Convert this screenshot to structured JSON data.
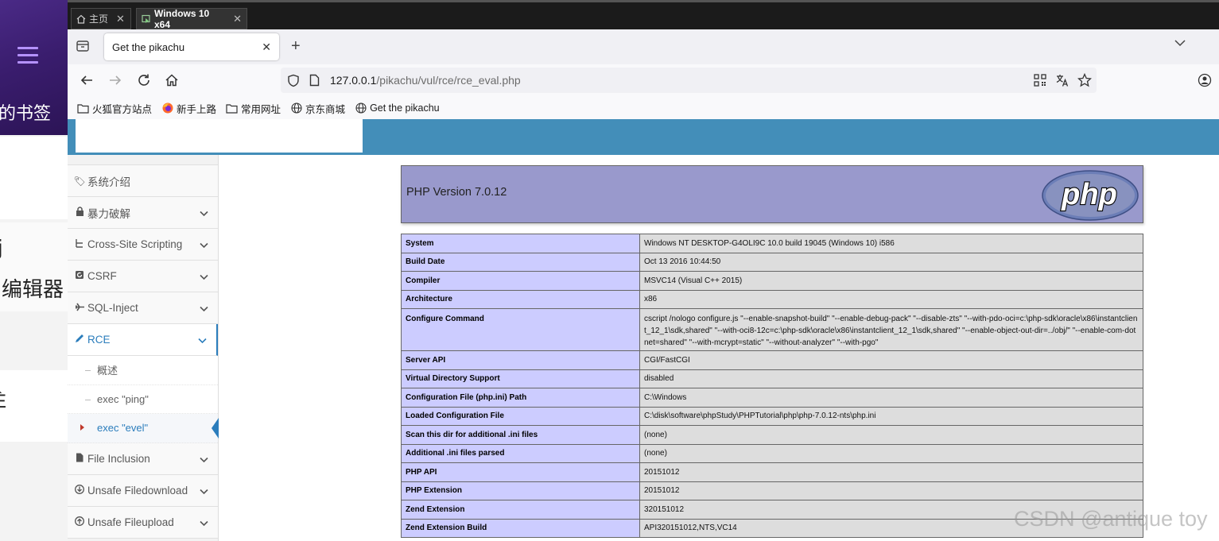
{
  "left_app": {
    "bookmarks_fragment": "的书签",
    "glyph_fragment": "j",
    "editor_fragment": "编辑器",
    "bottom_fragment": "È"
  },
  "vm_tabs": [
    {
      "label": "主页",
      "icon": "home-icon"
    },
    {
      "label": "Windows 10 x64",
      "icon": "vm-icon"
    }
  ],
  "browser": {
    "tab_title": "Get the pikachu",
    "url_host": "127.0.0.1",
    "url_path": "/pikachu/vul/rce/rce_eval.php",
    "bookmarks": [
      {
        "label": "火狐官方站点",
        "icon": "folder-icon"
      },
      {
        "label": "新手上路",
        "icon": "firefox-icon"
      },
      {
        "label": "常用网址",
        "icon": "folder-icon"
      },
      {
        "label": "京东商城",
        "icon": "globe-icon"
      },
      {
        "label": "Get the pikachu",
        "icon": "globe-icon"
      }
    ]
  },
  "sidebar": {
    "items": [
      {
        "label": "系统介绍",
        "icon": "tags-icon"
      },
      {
        "label": "暴力破解",
        "icon": "lock-icon"
      },
      {
        "label": "Cross-Site Scripting",
        "icon": "sitemap-icon"
      },
      {
        "label": "CSRF",
        "icon": "refresh-icon"
      },
      {
        "label": "SQL-Inject",
        "icon": "plane-icon"
      },
      {
        "label": "RCE",
        "icon": "pencil-icon"
      },
      {
        "label": "File Inclusion",
        "icon": "file-icon"
      },
      {
        "label": "Unsafe Filedownload",
        "icon": "download-icon"
      },
      {
        "label": "Unsafe Fileupload",
        "icon": "upload-icon"
      }
    ],
    "rce_sub": [
      {
        "label": "概述"
      },
      {
        "label": "exec \"ping\""
      },
      {
        "label": "exec \"evel\""
      }
    ]
  },
  "phpinfo": {
    "version_title": "PHP Version 7.0.12",
    "logo_text": "php",
    "rows": [
      {
        "key": "System",
        "value": "Windows NT DESKTOP-G4OLI9C 10.0 build 19045 (Windows 10) i586"
      },
      {
        "key": "Build Date",
        "value": "Oct 13 2016 10:44:50"
      },
      {
        "key": "Compiler",
        "value": "MSVC14 (Visual C++ 2015)"
      },
      {
        "key": "Architecture",
        "value": "x86"
      },
      {
        "key": "Configure Command",
        "value": "cscript /nologo configure.js \"--enable-snapshot-build\" \"--enable-debug-pack\" \"--disable-zts\" \"--with-pdo-oci=c:\\php-sdk\\oracle\\x86\\instantclient_12_1\\sdk,shared\" \"--with-oci8-12c=c:\\php-sdk\\oracle\\x86\\instantclient_12_1\\sdk,shared\" \"--enable-object-out-dir=../obj/\" \"--enable-com-dotnet=shared\" \"--with-mcrypt=static\" \"--without-analyzer\" \"--with-pgo\""
      },
      {
        "key": "Server API",
        "value": "CGI/FastCGI"
      },
      {
        "key": "Virtual Directory Support",
        "value": "disabled"
      },
      {
        "key": "Configuration File (php.ini) Path",
        "value": "C:\\Windows"
      },
      {
        "key": "Loaded Configuration File",
        "value": "C:\\disk\\software\\phpStudy\\PHPTutorial\\php\\php-7.0.12-nts\\php.ini"
      },
      {
        "key": "Scan this dir for additional .ini files",
        "value": "(none)"
      },
      {
        "key": "Additional .ini files parsed",
        "value": "(none)"
      },
      {
        "key": "PHP API",
        "value": "20151012"
      },
      {
        "key": "PHP Extension",
        "value": "20151012"
      },
      {
        "key": "Zend Extension",
        "value": "320151012"
      },
      {
        "key": "Zend Extension Build",
        "value": "API320151012,NTS,VC14"
      }
    ]
  },
  "watermark": "CSDN @antique toy"
}
